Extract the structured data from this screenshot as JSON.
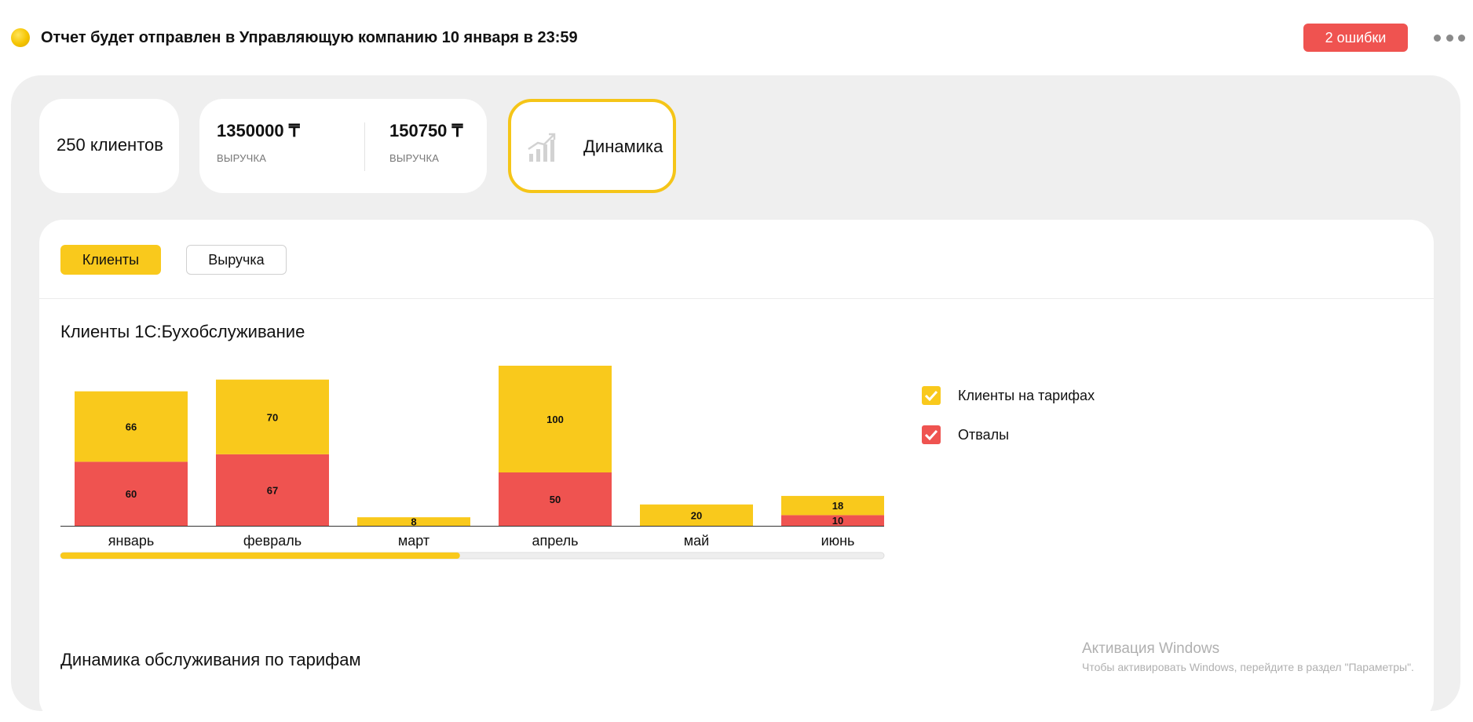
{
  "header": {
    "notice": "Отчет будет отправлен в Управляющую компанию 10 января в 23:59",
    "errors_button": "2 ошибки",
    "status_color": "#f5c400"
  },
  "summary": {
    "clients": "250 клиентов",
    "revenue": [
      {
        "value": "1350000 ₸",
        "label": "ВЫРУЧКА"
      },
      {
        "value": "150750 ₸",
        "label": "ВЫРУЧКА"
      }
    ],
    "dynamics_label": "Динамика"
  },
  "tabs": [
    {
      "label": "Клиенты",
      "active": true
    },
    {
      "label": "Выручка",
      "active": false
    }
  ],
  "sections": {
    "clients_title": "Клиенты 1С:Бухобслуживание",
    "dynamics_title": "Динамика обслуживания по тарифам"
  },
  "legend": [
    {
      "label": "Клиенты на тарифах",
      "color": "#f9c91c",
      "checked": true
    },
    {
      "label": "Отвалы",
      "color": "#ef5350",
      "checked": true
    }
  ],
  "scrollbar": {
    "position": 0.485
  },
  "chart_data": {
    "type": "bar",
    "stacked": true,
    "categories": [
      "январь",
      "февраль",
      "март",
      "апрель",
      "май",
      "июнь"
    ],
    "series": [
      {
        "name": "Отвалы",
        "color": "#ef5350",
        "values": [
          60,
          67,
          0,
          50,
          0,
          10
        ]
      },
      {
        "name": "Клиенты на тарифах",
        "color": "#f9c91c",
        "values": [
          66,
          70,
          8,
          100,
          20,
          18
        ]
      }
    ]
  },
  "os_watermark": {
    "title": "Активация Windows",
    "subtitle": "Чтобы активировать Windows, перейдите в раздел \"Параметры\"."
  }
}
